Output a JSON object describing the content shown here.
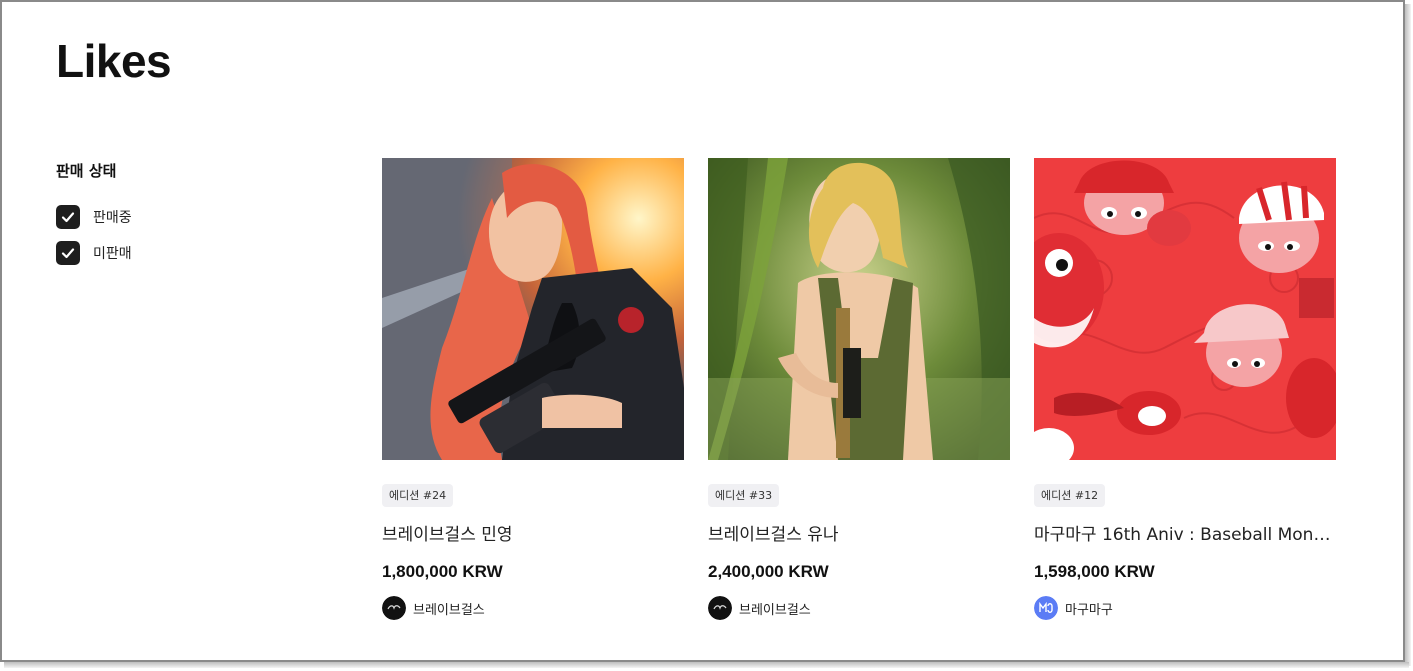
{
  "page": {
    "title": "Likes"
  },
  "filter": {
    "title": "판매 상태",
    "options": [
      {
        "label": "판매중",
        "checked": true
      },
      {
        "label": "미판매",
        "checked": true
      }
    ]
  },
  "items": [
    {
      "edition": "에디션 #24",
      "name": "브레이브걸스 민영",
      "price": "1,800,000 KRW",
      "creator": "브레이브걸스",
      "image": "red-haired-soldier-artwork",
      "avatar": "bg-logo-dark"
    },
    {
      "edition": "에디션 #33",
      "name": "브레이브걸스 유나",
      "price": "2,400,000 KRW",
      "creator": "브레이브걸스",
      "image": "blonde-soldier-jungle-artwork",
      "avatar": "bg-logo-dark"
    },
    {
      "edition": "에디션 #12",
      "name": "마구마구 16th Aniv : Baseball Monst…",
      "price": "1,598,000 KRW",
      "creator": "마구마구",
      "image": "baseball-monsters-pattern-artwork",
      "avatar": "mg-logo-blue"
    }
  ],
  "colors": {
    "checkbox": "#1e1e1e",
    "edition_badge": "#f0f0f3",
    "pattern_red": "#ee3d3f",
    "avatar_blue": "#5b7cf5"
  }
}
